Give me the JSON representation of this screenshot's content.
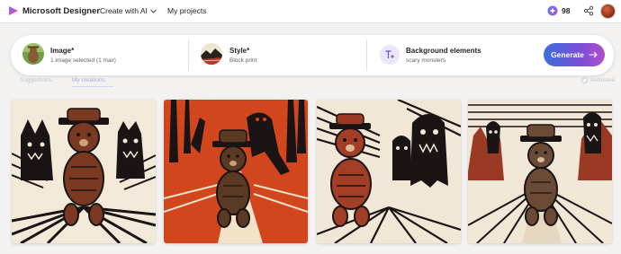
{
  "header": {
    "app_title": "Microsoft Designer",
    "nav_create": "Create with AI",
    "nav_projects": "My projects",
    "credits": "98"
  },
  "prompt_card": {
    "image_label": "Image*",
    "image_sub": "1 image selected (1 max)",
    "style_label": "Style*",
    "style_sub": "Block print",
    "background_label": "Background elements",
    "background_sub": "scary monsters",
    "generate_label": "Generate"
  },
  "tabs": {
    "left": "Suggestions",
    "active": "My creations",
    "autosave": "Autosave"
  },
  "results": [
    {
      "name": "result-image-1"
    },
    {
      "name": "result-image-2"
    },
    {
      "name": "result-image-3"
    },
    {
      "name": "result-image-4"
    }
  ],
  "colors": {
    "accent_gradient_start": "#3a6fdc",
    "accent_gradient_end": "#b04fc8",
    "brown": "#7a3a22",
    "orange_red": "#d2461e",
    "ink": "#1a1414",
    "paper": "#f1e7d6"
  },
  "icons": {
    "logo": "designer-logo-icon",
    "create_chevron": "chevron-down-icon",
    "credits": "credits-icon",
    "share": "share-icon",
    "generate_arrow": "arrow-right-icon",
    "background": "text-add-icon"
  }
}
